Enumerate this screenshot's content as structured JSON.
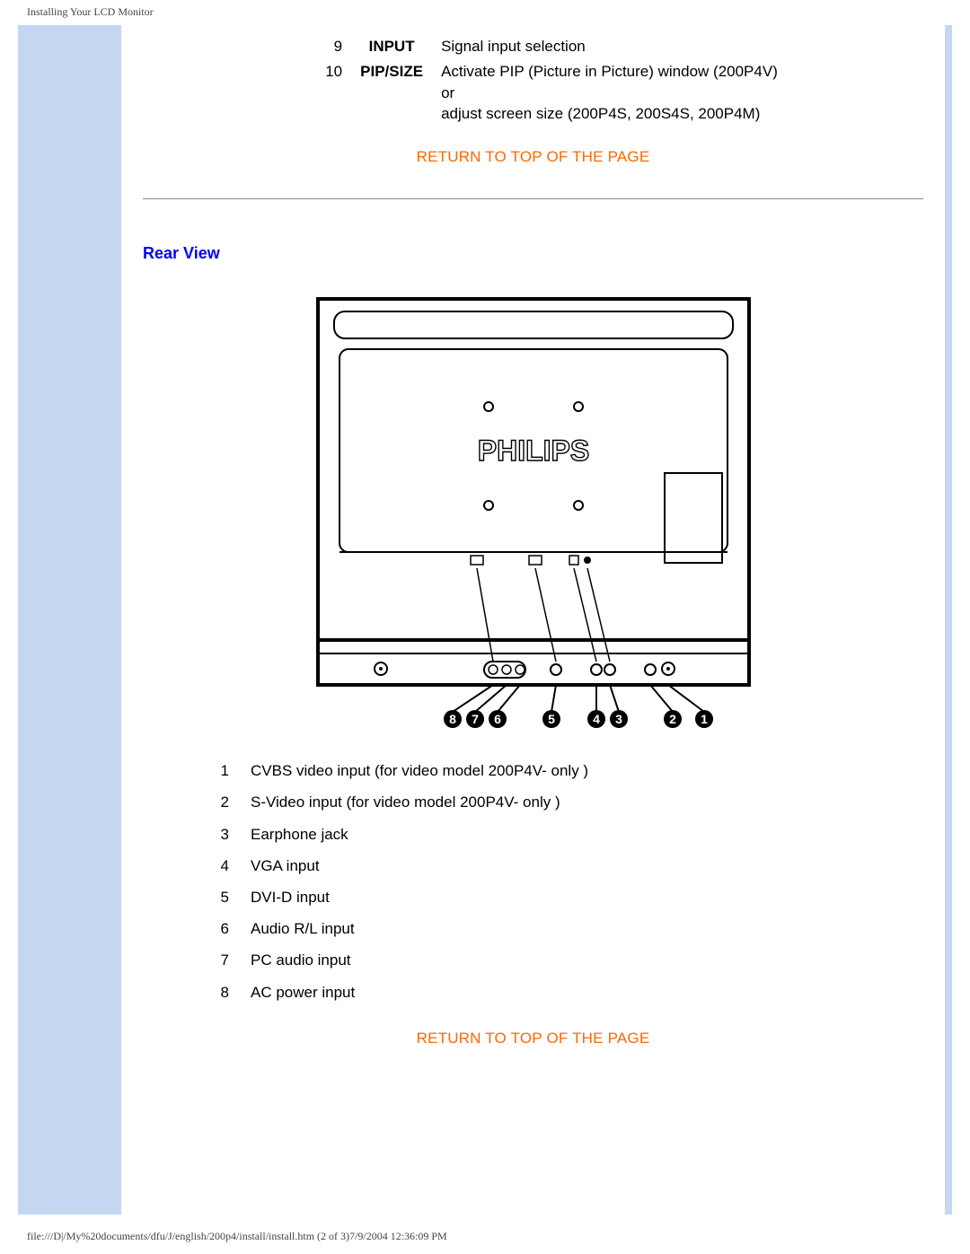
{
  "header": "Installing Your LCD Monitor",
  "footer": "file:///D|/My%20documents/dfu/J/english/200p4/install/install.htm (2 of 3)7/9/2004 12:36:09 PM",
  "top_rows": [
    {
      "num": "9",
      "label": "INPUT",
      "desc": "Signal input selection"
    },
    {
      "num": "10",
      "label": "PIP/SIZE",
      "desc": "Activate PIP (Picture in Picture) window (200P4V)\nor\nadjust screen size (200P4S, 200S4S, 200P4M)"
    }
  ],
  "return_top": "RETURN TO TOP OF THE PAGE",
  "rear_heading": "Rear View",
  "brand_logo": "PHILIPS",
  "rear_items": [
    {
      "n": "1",
      "d": "CVBS video input (for video model 200P4V- only )"
    },
    {
      "n": "2",
      "d": "S-Video input (for video model 200P4V- only )"
    },
    {
      "n": "3",
      "d": "Earphone jack"
    },
    {
      "n": "4",
      "d": "VGA input"
    },
    {
      "n": "5",
      "d": "DVI-D input"
    },
    {
      "n": "6",
      "d": "Audio R/L input"
    },
    {
      "n": "7",
      "d": "PC audio input"
    },
    {
      "n": "8",
      "d": "AC power input"
    }
  ],
  "callouts": [
    "8",
    "7",
    "6",
    "5",
    "4",
    "3",
    "2",
    "1"
  ]
}
